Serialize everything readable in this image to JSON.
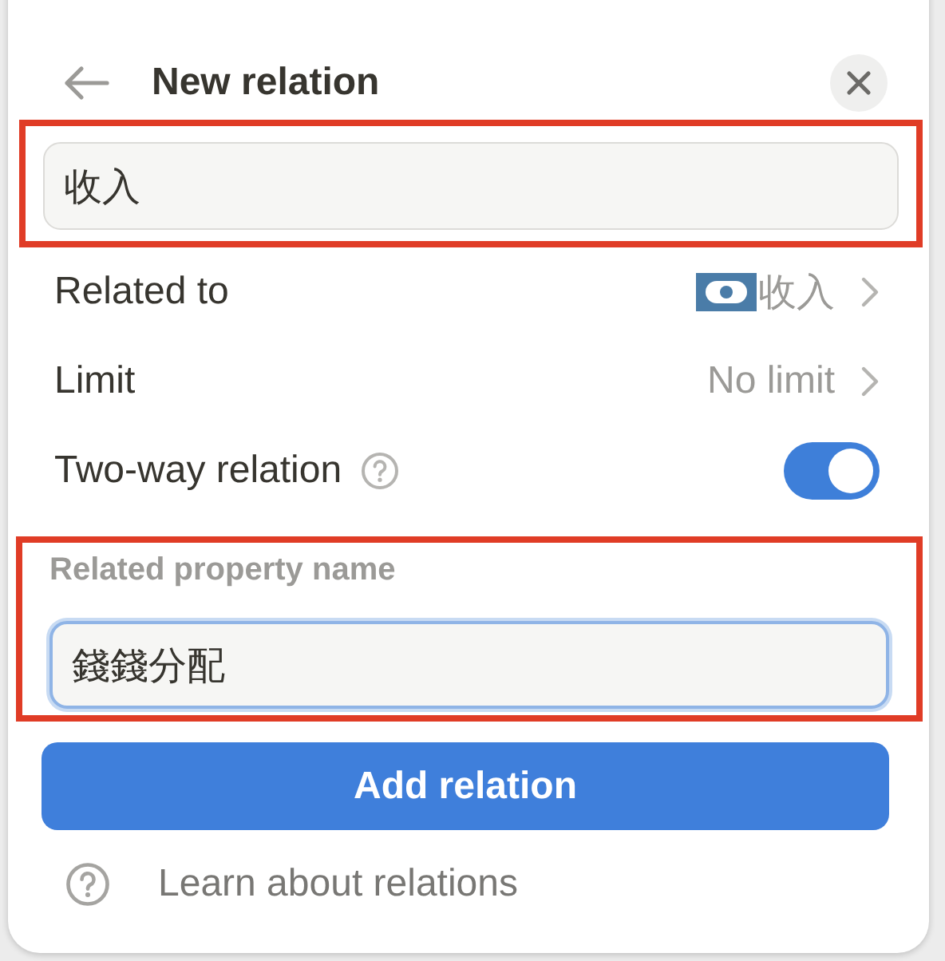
{
  "header": {
    "title": "New relation"
  },
  "name_field": {
    "value": "收入",
    "highlighted": true
  },
  "settings": [
    {
      "kind": "link",
      "label": "Related to",
      "value": "收入",
      "has_icon": true
    },
    {
      "kind": "link",
      "label": "Limit",
      "value": "No limit",
      "has_icon": false
    },
    {
      "kind": "toggle",
      "label": "Two-way relation",
      "on": true
    }
  ],
  "related_property": {
    "label": "Related property name",
    "value": "錢錢分配",
    "focused": true,
    "highlighted": true
  },
  "primary_button": "Add relation",
  "help_link": "Learn about relations"
}
